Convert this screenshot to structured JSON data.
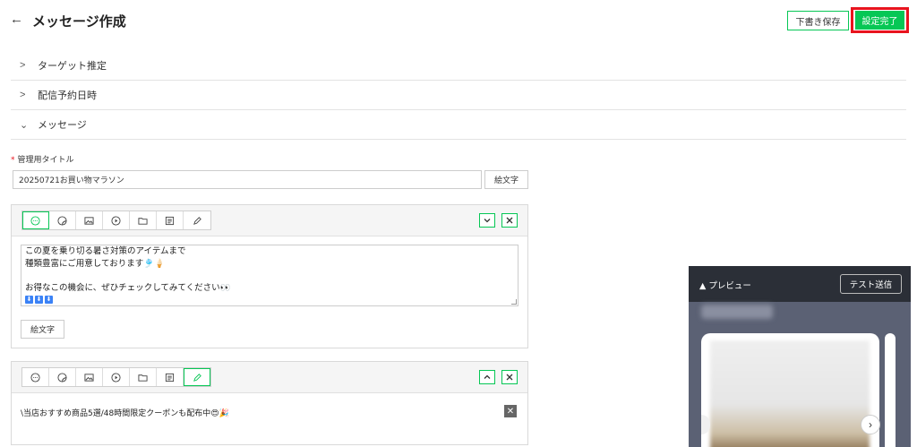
{
  "header": {
    "back_icon": "arrow-left-icon",
    "title": "メッセージ作成",
    "draft_label": "下書き保存",
    "complete_label": "設定完了"
  },
  "sections": [
    {
      "label": "ターゲット推定",
      "expanded": false
    },
    {
      "label": "配信予約日時",
      "expanded": false
    },
    {
      "label": "メッセージ",
      "expanded": true
    }
  ],
  "title_field": {
    "label": "管理用タイトル",
    "required_mark": "*",
    "value": "20250721お買い物マラソン",
    "emoji_button": "絵文字"
  },
  "toolbar_icons": [
    "chat-bubble-icon",
    "sticker-icon",
    "image-icon",
    "video-icon",
    "folder-icon",
    "list-icon",
    "pen-icon"
  ],
  "message_card": {
    "lines": [
      "この夏を乗り切る暑さ対策のアイテムまで",
      "種類豊富にご用意しております🎐🍦",
      "",
      "お得なこの機会に、ぜひチェックしてみてください👀"
    ],
    "arrows": [
      "⬇",
      "⬇",
      "⬇"
    ],
    "emoji_button": "絵文字"
  },
  "second_card": {
    "text": "\\当店おすすめ商品5選/48時間限定クーポンも配布中😍🎉"
  },
  "preview": {
    "title": "▲ プレビュー",
    "test_send_label": "テスト送信",
    "next_icon": "chevron-right-icon"
  },
  "colors": {
    "accent": "#06c755",
    "highlight": "#e8141e",
    "preview_bg": "#5b6174",
    "preview_header": "#2b2f37"
  }
}
